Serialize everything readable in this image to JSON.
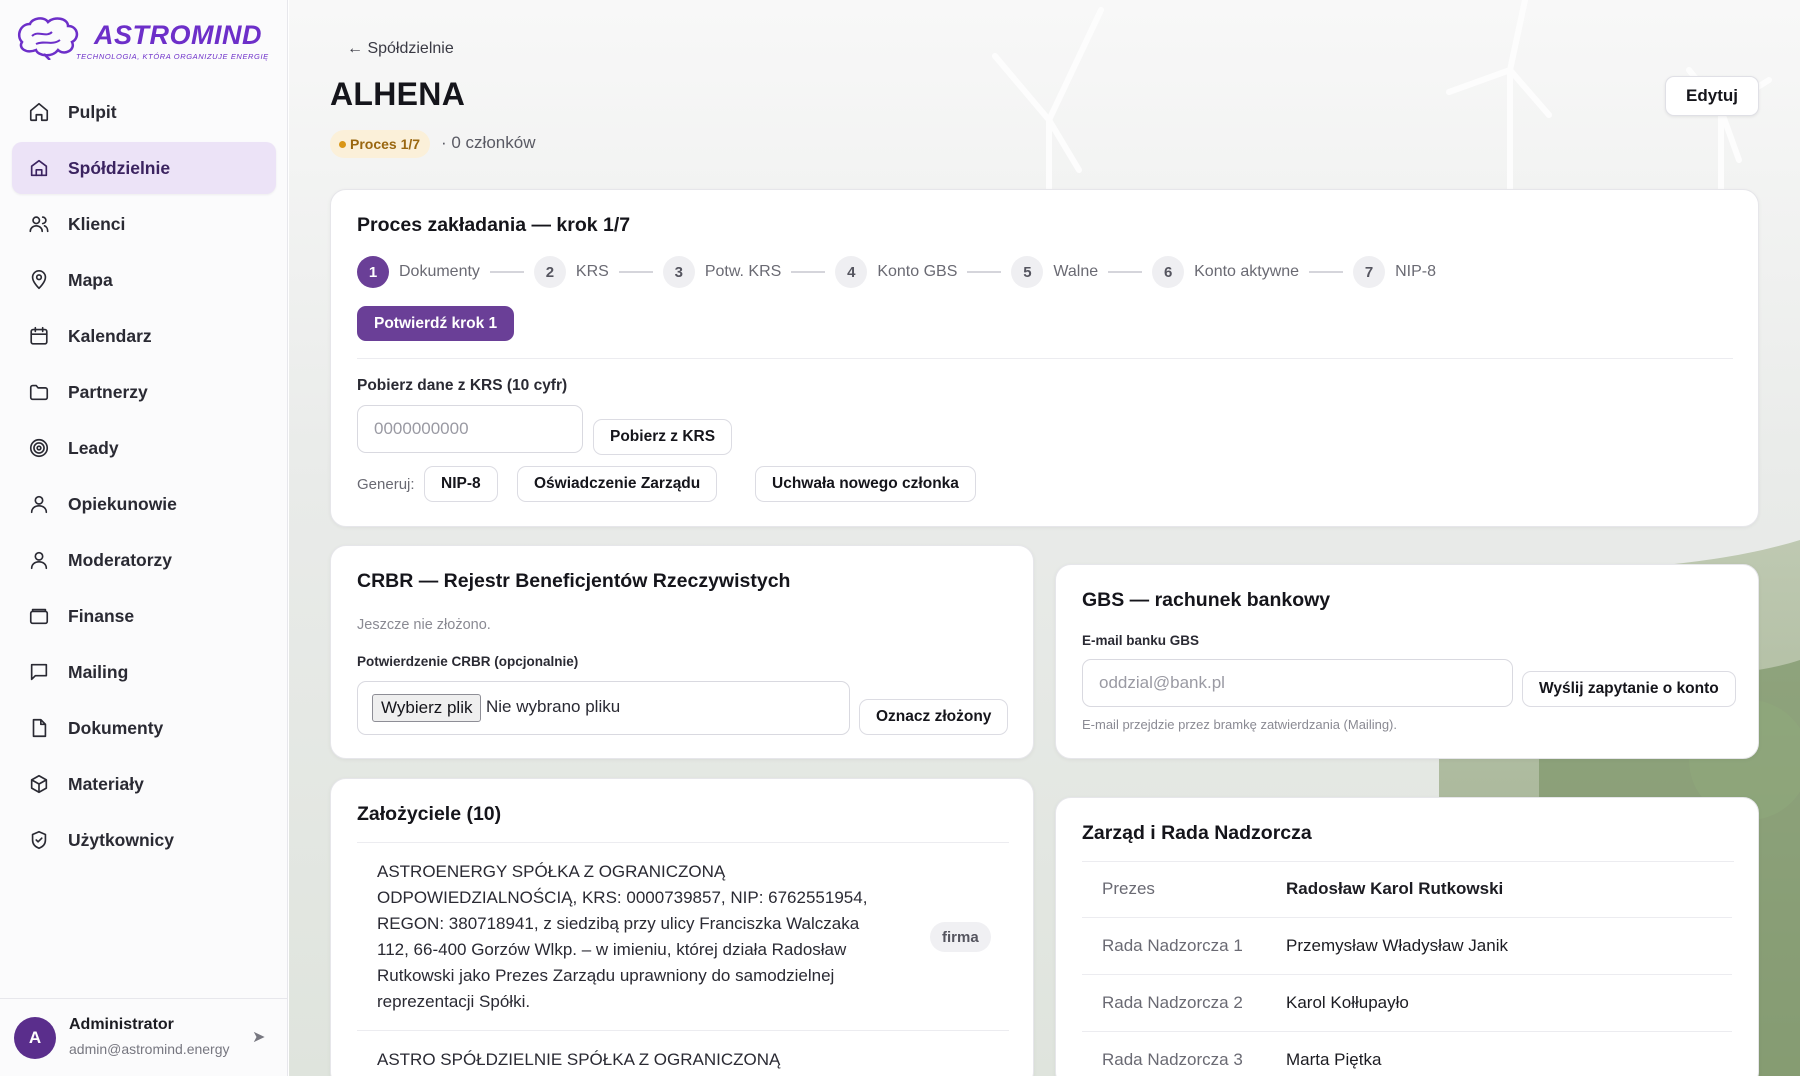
{
  "brand": {
    "name": "ASTROMIND",
    "tagline": "TECHNOLOGIA, KTÓRA ORGANIZUJE ENERGIĘ",
    "accent": "#6d2fc9"
  },
  "sidebar": {
    "items": [
      {
        "label": "Pulpit",
        "icon": "home-icon"
      },
      {
        "label": "Spółdzielnie",
        "icon": "store-icon",
        "active": true
      },
      {
        "label": "Klienci",
        "icon": "users-icon"
      },
      {
        "label": "Mapa",
        "icon": "map-pin-icon"
      },
      {
        "label": "Kalendarz",
        "icon": "calendar-icon"
      },
      {
        "label": "Partnerzy",
        "icon": "folder-icon"
      },
      {
        "label": "Leady",
        "icon": "target-icon"
      },
      {
        "label": "Opiekunowie",
        "icon": "user-icon"
      },
      {
        "label": "Moderatorzy",
        "icon": "user-icon"
      },
      {
        "label": "Finanse",
        "icon": "wallet-icon"
      },
      {
        "label": "Mailing",
        "icon": "message-icon"
      },
      {
        "label": "Dokumenty",
        "icon": "file-icon"
      },
      {
        "label": "Materiały",
        "icon": "box-icon"
      },
      {
        "label": "Użytkownicy",
        "icon": "shield-check-icon"
      }
    ],
    "user": {
      "initial": "A",
      "name": "Administrator",
      "email": "admin@astromind.energy",
      "arrow": "➤"
    }
  },
  "header": {
    "back_label": "← Spółdzielnie",
    "title": "ALHENA",
    "status_badge": "Proces 1/7",
    "members": "· 0 członków",
    "edit_label": "Edytuj"
  },
  "process": {
    "title": "Proces zakładania — krok 1/7",
    "steps": [
      {
        "num": "1",
        "label": "Dokumenty"
      },
      {
        "num": "2",
        "label": "KRS"
      },
      {
        "num": "3",
        "label": "Potw. KRS"
      },
      {
        "num": "4",
        "label": "Konto GBS"
      },
      {
        "num": "5",
        "label": "Walne"
      },
      {
        "num": "6",
        "label": "Konto aktywne"
      },
      {
        "num": "7",
        "label": "NIP-8"
      }
    ],
    "active_step": 1,
    "confirm_label": "Potwierdź krok 1",
    "krs_label": "Pobierz dane z KRS (10 cyfr)",
    "krs_placeholder": "0000000000",
    "krs_button": "Pobierz z KRS",
    "generate_label": "Generuj:",
    "generate_buttons": [
      "NIP-8",
      "Oświadczenie Zarządu",
      "Uchwała nowego członka"
    ]
  },
  "crbr": {
    "title": "CRBR — Rejestr Beneficjentów Rzeczywistych",
    "status": "Jeszcze nie złożono.",
    "file_label": "Potwierdzenie CRBR (opcjonalnie)",
    "file_button": "Wybierz plik",
    "file_status": "Nie wybrano pliku",
    "mark_button": "Oznacz złożony"
  },
  "gbs": {
    "title": "GBS — rachunek bankowy",
    "email_label": "E-mail banku GBS",
    "email_placeholder": "oddzial@bank.pl",
    "send_button": "Wyślij zapytanie o konto",
    "hint": "E-mail przejdzie przez bramkę zatwierdzania (Mailing)."
  },
  "founders": {
    "title": "Założyciele (10)",
    "items": [
      {
        "text": "ASTROENERGY SPÓŁKA Z OGRANICZONĄ ODPOWIEDZIALNOŚCIĄ, KRS: 0000739857, NIP: 6762551954, REGON: 380718941, z siedzibą przy ulicy Franciszka Walczaka 112, 66-400 Gorzów Wlkp. – w imieniu, której działa Radosław Rutkowski jako Prezes Zarządu uprawniony do samodzielnej reprezentacji Spółki.",
        "tag": "firma"
      },
      {
        "text": "ASTRO SPÓŁDZIELNIE SPÓŁKA Z OGRANICZONĄ",
        "tag": ""
      }
    ]
  },
  "board": {
    "title": "Zarząd i Rada Nadzorcza",
    "rows": [
      {
        "role": "Prezes",
        "person": "Radosław Karol Rutkowski"
      },
      {
        "role": "Rada Nadzorcza 1",
        "person": "Przemysław Władysław Janik"
      },
      {
        "role": "Rada Nadzorcza 2",
        "person": "Karol Kołłupayło"
      },
      {
        "role": "Rada Nadzorcza 3",
        "person": "Marta Piętka"
      }
    ]
  }
}
